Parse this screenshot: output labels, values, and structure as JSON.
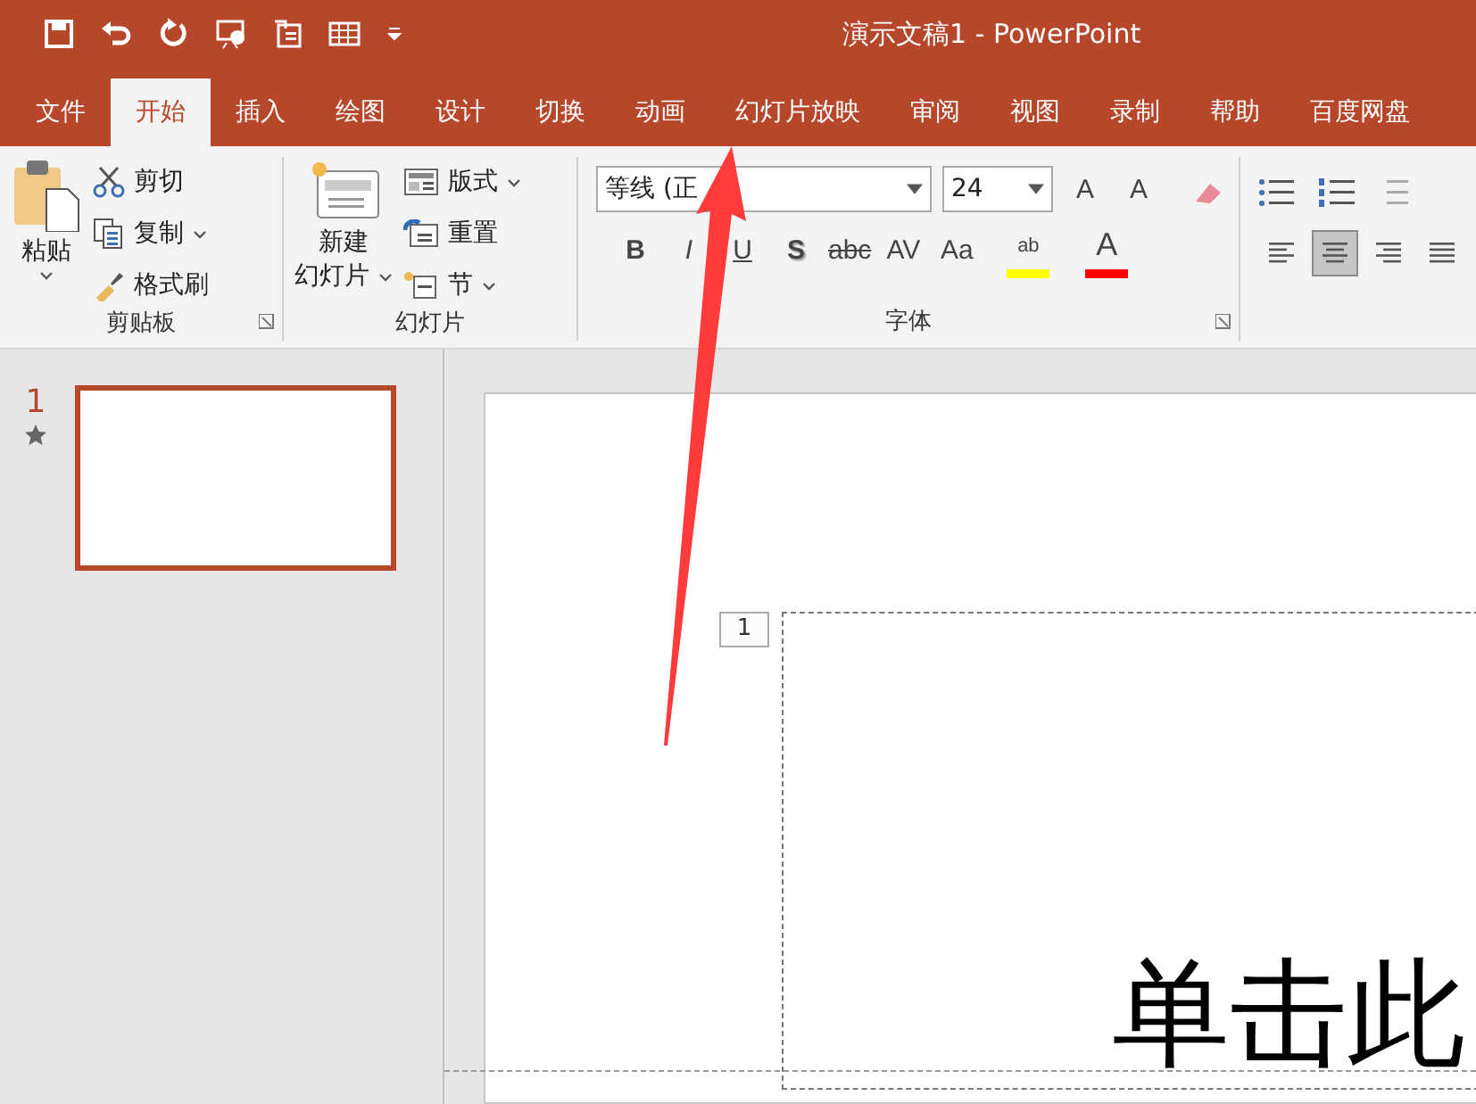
{
  "window": {
    "title": "演示文稿1  -  PowerPoint"
  },
  "tabs": [
    {
      "label": "文件",
      "selected": false
    },
    {
      "label": "开始",
      "selected": true
    },
    {
      "label": "插入",
      "selected": false
    },
    {
      "label": "绘图",
      "selected": false
    },
    {
      "label": "设计",
      "selected": false
    },
    {
      "label": "切换",
      "selected": false
    },
    {
      "label": "动画",
      "selected": false
    },
    {
      "label": "幻灯片放映",
      "selected": false
    },
    {
      "label": "审阅",
      "selected": false
    },
    {
      "label": "视图",
      "selected": false
    },
    {
      "label": "录制",
      "selected": false
    },
    {
      "label": "帮助",
      "selected": false
    },
    {
      "label": "百度网盘",
      "selected": false
    }
  ],
  "clipboard": {
    "paste": "粘贴",
    "cut": "剪切",
    "copy": "复制",
    "format_painter": "格式刷",
    "label": "剪贴板"
  },
  "slides_group": {
    "new_slide": [
      "新建",
      "幻灯片"
    ],
    "layout": "版式",
    "reset": "重置",
    "section": "节",
    "label": "幻灯片"
  },
  "font_group": {
    "font_name": "等线 (正",
    "font_size": "24",
    "grow": "A",
    "shrink": "A",
    "styles": [
      {
        "text": "B",
        "kind": "bold"
      },
      {
        "text": "I",
        "kind": "italic"
      },
      {
        "text": "U",
        "kind": "underline"
      },
      {
        "text": "S",
        "kind": "shadow"
      },
      {
        "text": "abc",
        "kind": "strike"
      },
      {
        "text": "AV",
        "kind": "spacing"
      },
      {
        "text": "Aa",
        "kind": "case"
      }
    ],
    "highlight": "ab",
    "font_color": "A",
    "label": "字体"
  },
  "paragraph_group": {
    "alignments": [
      {
        "kind": "left",
        "selected": false
      },
      {
        "kind": "center",
        "selected": true
      },
      {
        "kind": "right",
        "selected": false
      },
      {
        "kind": "justify",
        "selected": false
      }
    ]
  },
  "thumbnails": [
    {
      "number": "1",
      "selected": true
    }
  ],
  "slide": {
    "placeholder_number": "1",
    "title": "单击此"
  }
}
